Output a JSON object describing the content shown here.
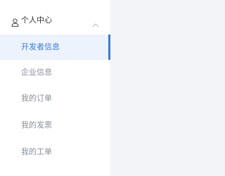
{
  "sidebar": {
    "group": {
      "icon": "user-icon",
      "label": "个人中心",
      "toggle_icon": "chevron-up-icon"
    },
    "items": [
      {
        "label": "开发者信息",
        "active": true
      },
      {
        "label": "企业信息",
        "active": false
      },
      {
        "label": "我的订单",
        "active": false
      },
      {
        "label": "我的发票",
        "active": false
      },
      {
        "label": "我的工单",
        "active": false
      }
    ]
  },
  "colors": {
    "accent": "#3a7be0",
    "active_background": "#edf3fd",
    "item_text": "#8a8f99",
    "group_text": "#333333",
    "content_background": "#f2f4f8"
  }
}
